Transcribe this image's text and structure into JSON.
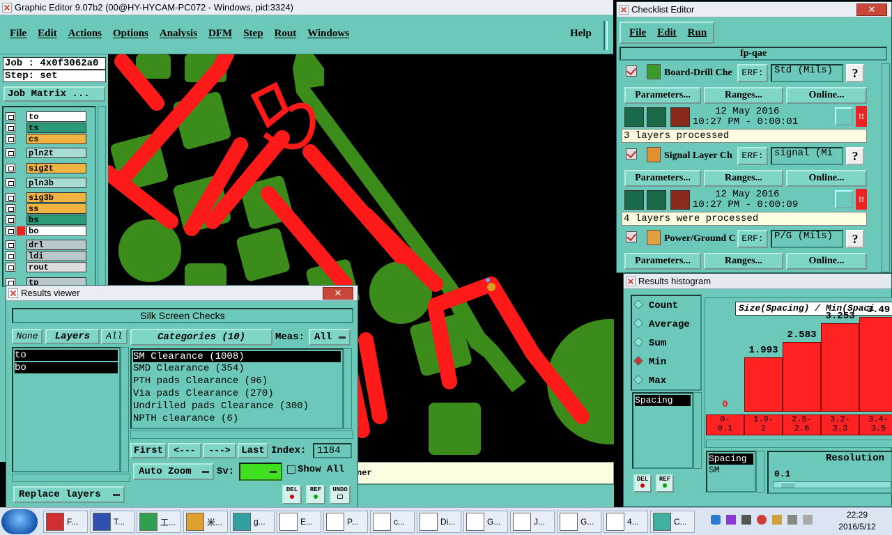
{
  "main_window": {
    "title": "Graphic Editor 9.07b2 (00@HY-HYCAM-PC072 - Windows, pid:3324)",
    "menu": [
      "File",
      "Edit",
      "Actions",
      "Options",
      "Analysis",
      "DFM",
      "Step",
      "Rout",
      "Windows"
    ],
    "help": "Help",
    "job_label": "Job : 4x0f3062a0",
    "step_label": "Step: set",
    "job_matrix": "Job Matrix ...",
    "layers": [
      {
        "name": "to",
        "color": "#ffffff"
      },
      {
        "name": "ts",
        "color": "#2a9a7a"
      },
      {
        "name": "cs",
        "color": "#f2b440"
      },
      {
        "name": "pln2t",
        "color": "#a8dcd4"
      },
      {
        "name": "sig2t",
        "color": "#f2b440"
      },
      {
        "name": "pln3b",
        "color": "#a8dcd4"
      },
      {
        "name": "sig3b",
        "color": "#f2b440"
      },
      {
        "name": "ss",
        "color": "#f2b440"
      },
      {
        "name": "bs",
        "color": "#2a9a7a"
      },
      {
        "name": "bo",
        "color": "#ffffff"
      },
      {
        "name": "drl",
        "color": "#b8c8cc"
      },
      {
        "name": "ldi",
        "color": "#b8c8cc"
      },
      {
        "name": "rout",
        "color": "#dddddd"
      },
      {
        "name": "tp",
        "color": "#b8c8cc"
      }
    ],
    "status_text": "ner"
  },
  "results_viewer": {
    "title": "Results viewer",
    "header": "Silk Screen Checks",
    "none_btn": "None",
    "layers_label": "Layers",
    "all_btn": "All",
    "layer_items": [
      "to",
      "bo"
    ],
    "categories_label": "Categories (10)",
    "meas_label": "Meas:",
    "meas_value": "All",
    "categories": [
      "SM Clearance (1008)",
      "SMD Clearance (354)",
      "PTH pads Clearance (96)",
      "Via pads Clearance (270)",
      "Undrilled pads Clearance (300)",
      "NPTH clearance (6)"
    ],
    "first": "First",
    "prev": "<---",
    "next": "--->",
    "last": "Last",
    "index_label": "Index:",
    "index_value": "1184",
    "auto_zoom": "Auto Zoom",
    "sv_label": "Sv:",
    "show_all": "Show All",
    "replace_layers": "Replace layers",
    "del": "DEL",
    "ref": "REF",
    "undo": "UNDO"
  },
  "checklist": {
    "title": "Checklist Editor",
    "menu": [
      "File",
      "Edit",
      "Run"
    ],
    "name": "fp-qae",
    "erf_label": "ERF:",
    "params_btn": "Parameters...",
    "ranges_btn": "Ranges...",
    "online_btn": "Online...",
    "help_btn": "?",
    "items": [
      {
        "name": "Board-Drill Che",
        "erf": "Std (Mils)",
        "date": "12 May 2016",
        "time": "10:27 PM - 0:00:01",
        "status": "3 layers processed"
      },
      {
        "name": "Signal Layer Ch",
        "erf": "signal (Mi",
        "date": "12 May 2016",
        "time": "10:27 PM - 0:00:09",
        "status": "4 layers were processed"
      },
      {
        "name": "Power/Ground C",
        "erf": "P/G (Mils)"
      }
    ]
  },
  "histogram": {
    "title": "Results histogram",
    "modes": [
      "Count",
      "Average",
      "Sum",
      "Min",
      "Max"
    ],
    "selected_mode": "Min",
    "chart_title": "Size(Spacing) / Min(Spaci",
    "list_item": "Spacing",
    "bars": [
      {
        "label": "0",
        "range": "0-\n0.1",
        "value": 0
      },
      {
        "label": "1.993",
        "range": "1.9-\n2",
        "value": 1.993
      },
      {
        "label": "2.583",
        "range": "2.5-\n2.6",
        "value": 2.583
      },
      {
        "label": "3.253",
        "range": "3.2-\n3.3",
        "value": 3.253
      },
      {
        "label": "3.49",
        "range": "3.4-\n3.5",
        "value": 3.49
      }
    ],
    "spacing_sel": "Spacing",
    "spacing_sub": "SM",
    "resolution_label": "Resolution",
    "resolution_value": "0.1",
    "del": "DEL",
    "ref": "REF"
  },
  "taskbar": {
    "items": [
      "F...",
      "T...",
      "工...",
      "米...",
      "g...",
      "E...",
      "P...",
      "c...",
      "Di...",
      "G...",
      "J...",
      "G...",
      "4...",
      "C..."
    ],
    "time": "22:29",
    "date": "2016/5/12"
  },
  "colors": {
    "ui": "#6cc8b8",
    "pad_green": "#3c8c1c",
    "trace_red": "#ff1a1a"
  }
}
